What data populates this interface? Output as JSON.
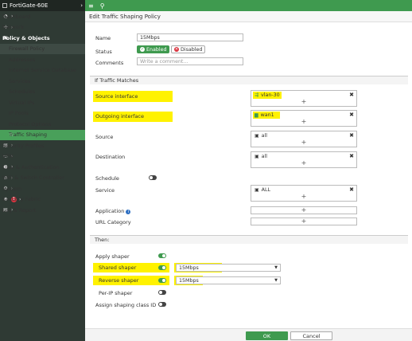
{
  "sidebar": {
    "device": "FortiGate-60E",
    "items": [
      {
        "icon": "dashboard-icon",
        "glyph": "◔",
        "label": "Dashboard",
        "chev": "›"
      },
      {
        "icon": "network-icon",
        "glyph": "✣",
        "label": "Network",
        "chev": "›"
      },
      {
        "icon": "policy-objects-icon",
        "glyph": "▣",
        "label": "Policy & Objects",
        "chev": "⌄"
      },
      {
        "label": "Firewall Policy"
      },
      {
        "label": "Addresses"
      },
      {
        "label": "Internet Service Database"
      },
      {
        "label": "Services"
      },
      {
        "label": "Schedules"
      },
      {
        "label": "Virtual IPs"
      },
      {
        "label": "IP Pools"
      },
      {
        "label": "Protocol Options"
      },
      {
        "label": "Traffic Shaping",
        "star": "☆"
      },
      {
        "icon": "security-profiles-icon",
        "glyph": "🔒",
        "label": "Security Profiles",
        "chev": "›"
      },
      {
        "icon": "vpn-icon",
        "glyph": "▭",
        "label": "VPN",
        "chev": "›"
      },
      {
        "icon": "user-auth-icon",
        "glyph": "👤",
        "label": "User & Authentication",
        "chev": "›"
      },
      {
        "icon": "wifi-switch-icon",
        "glyph": "⊜",
        "label": "WiFi & Switch Controller",
        "chev": "›"
      },
      {
        "icon": "system-icon",
        "glyph": "⚙",
        "label": "System",
        "chev": "›"
      },
      {
        "icon": "security-fabric-icon",
        "glyph": "✺",
        "label": "Security Fabric",
        "badge": "1",
        "chev": "›"
      },
      {
        "icon": "log-report-icon",
        "glyph": "▤",
        "label": "Log & Report",
        "chev": "›"
      }
    ]
  },
  "topbar": {
    "menu_icon": "≡",
    "search_icon": "🔍"
  },
  "main": {
    "title": "Edit Traffic Shaping Policy",
    "name_label": "Name",
    "name_value": "15Mbps",
    "status_label": "Status",
    "status_enabled": "Enabled",
    "status_disabled": "Disabled",
    "comments_label": "Comments",
    "comments_placeholder": "Write a comment...",
    "comments_counter": "⁄⁄",
    "section_matches": "If Traffic Matches",
    "source_interface_label": "Source interface",
    "source_interface_value": "vlan-30",
    "outgoing_interface_label": "Outgoing interface",
    "outgoing_interface_value": "wan1",
    "source_label": "Source",
    "source_value": "all",
    "destination_label": "Destination",
    "destination_value": "all",
    "schedule_label": "Schedule",
    "service_label": "Service",
    "service_value": "ALL",
    "application_label": "Application",
    "url_category_label": "URL Category",
    "section_then": "Then:",
    "apply_shaper_label": "Apply shaper",
    "shared_shaper_label": "Shared shaper",
    "shared_shaper_value": "15Mbps",
    "reverse_shaper_label": "Reverse shaper",
    "reverse_shaper_value": "15Mbps",
    "per_ip_shaper_label": "Per-IP shaper",
    "assign_class_label": "Assign shaping class ID",
    "plus": "+",
    "remove": "✖"
  },
  "footer": {
    "ok": "OK",
    "cancel": "Cancel"
  },
  "colors": {
    "accent": "#3f9a4f",
    "highlight": "#fff200",
    "sidebar": "#2f3a34"
  }
}
